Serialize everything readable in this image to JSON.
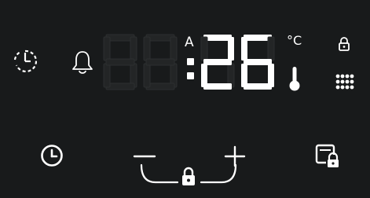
{
  "display": {
    "digits": [
      "",
      "",
      "2",
      "6"
    ],
    "colon": true,
    "mode_letter": "A",
    "temperature_unit": "°C"
  },
  "indicators": [
    "auto-cook-icon",
    "alarm-bell-icon",
    "thermometer-icon",
    "child-lock-icon",
    "program-grid-icon"
  ],
  "controls": {
    "buttons": [
      "clock-button",
      "minus-button",
      "plus-button",
      "lock-button",
      "panel-lock-button"
    ]
  },
  "colors": {
    "background": "#181a1b",
    "lit": "#ffffff",
    "unlit": "#232526"
  }
}
